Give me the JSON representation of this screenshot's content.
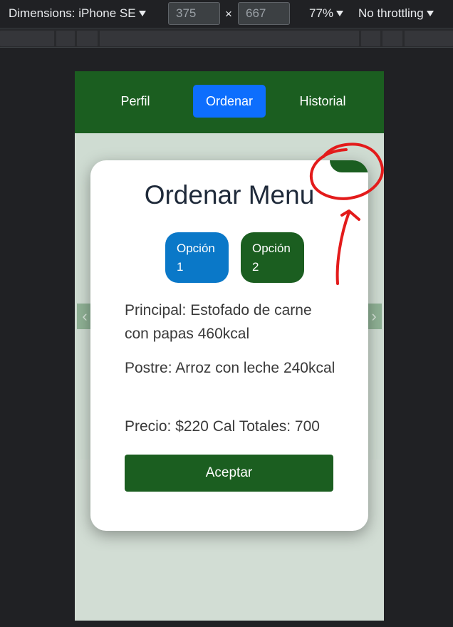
{
  "devtools": {
    "dimensions_label": "Dimensions: iPhone SE",
    "width_value": "375",
    "height_value": "667",
    "times_symbol": "×",
    "zoom_label": "77%",
    "throttling_label": "No throttling"
  },
  "nav": {
    "items": [
      {
        "label": "Perfil",
        "active": false
      },
      {
        "label": "Ordenar",
        "active": true
      },
      {
        "label": "Historial",
        "active": false
      }
    ]
  },
  "carousel": {
    "prev_icon": "‹",
    "next_icon": "›"
  },
  "modal": {
    "title": "Ordenar Menu",
    "options": [
      {
        "label_line1": "Opción",
        "label_line2": "1",
        "color": "#0a78c8"
      },
      {
        "label_line1": "Opción",
        "label_line2": "2",
        "color": "#1b5e20"
      }
    ],
    "principal": "Principal: Estofado de carne con papas 460kcal",
    "postre": "Postre: Arroz con leche 240kcal",
    "precio": "Precio: $220 Cal Totales: 700",
    "accept_label": "Aceptar"
  },
  "colors": {
    "nav_bg": "#1b5e20",
    "active_tab": "#0d6efd",
    "annotation": "#e31b1b"
  }
}
